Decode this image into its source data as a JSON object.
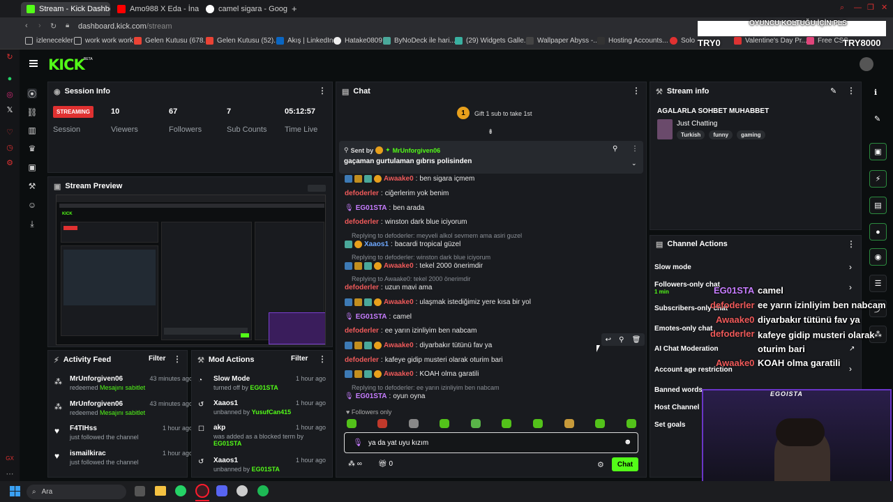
{
  "browser": {
    "tabs": [
      {
        "label": "Stream - Kick Dashboard",
        "active": true
      },
      {
        "label": "Amo988 X Eda - İnanırım",
        "active": false
      },
      {
        "label": "camel sigara - Google'da",
        "active": false
      }
    ],
    "new_tab": "+",
    "url_host": "dashboard.kick.com",
    "url_path": "/stream",
    "bookmarks": [
      "izlenecekler",
      "work work work",
      "Gelen Kutusu (678...",
      "Gelen Kutusu (52)...",
      "Akış | LinkedIn",
      "Hatake0809",
      "ByNoDeck ile hari...",
      "(29) Widgets Galle...",
      "Wallpaper Abyss -...",
      "Hosting Accounts...",
      "Solo -",
      "Valentine's Day Pr...",
      "Free CSS"
    ]
  },
  "kick": {
    "logo": "KICK",
    "logo_badge": "BETA"
  },
  "session": {
    "title": "Session Info",
    "badge": "STREAMING",
    "badge_sub": "Session",
    "stats": [
      {
        "value": "10",
        "label": "Viewers"
      },
      {
        "value": "67",
        "label": "Followers"
      },
      {
        "value": "7",
        "label": "Sub Counts"
      },
      {
        "value": "05:12:57",
        "label": "Time Live"
      }
    ]
  },
  "preview": {
    "title": "Stream Preview"
  },
  "activity": {
    "title": "Activity Feed",
    "filter": "Filter",
    "items": [
      {
        "user": "MrUnforgiven06",
        "action": "redeemed",
        "reward": "Mesajını sabitlet",
        "time": "43 minutes ago"
      },
      {
        "user": "MrUnforgiven06",
        "action": "redeemed",
        "reward": "Mesajını sabitlet",
        "time": "43 minutes ago"
      },
      {
        "user": "F4TIHss",
        "action": "just followed the channel",
        "reward": "",
        "time": "1 hour ago"
      },
      {
        "user": "ismailkirac",
        "action": "just followed the channel",
        "reward": "",
        "time": "1 hour ago"
      }
    ]
  },
  "mod": {
    "title": "Mod Actions",
    "filter": "Filter",
    "items": [
      {
        "title": "Slow Mode",
        "sub": "turned off by",
        "by": "EG01STA",
        "time": "1 hour ago"
      },
      {
        "title": "Xaaos1",
        "sub": "unbanned by",
        "by": "YusufCan415",
        "time": "1 hour ago"
      },
      {
        "title": "akp",
        "sub": "was added as a blocked term by",
        "by": "EG01STA",
        "time": "1 hour ago"
      },
      {
        "title": "Xaaos1",
        "sub": "unbanned by",
        "by": "EG01STA",
        "time": "1 hour ago"
      }
    ]
  },
  "chat": {
    "title": "Chat",
    "gift_count": "1",
    "gift_text": "Gift 1 sub to take 1st",
    "pinned_sent_by": "Sent by",
    "pinned_user": "MrUnforgiven06",
    "pinned_text": "gaçaman gurtulaman gıbrıs polisinden",
    "messages": [
      {
        "user": "Awaake0",
        "color": "#f05a5a",
        "text": "ben sigara içmem",
        "badges": true,
        "reply": ""
      },
      {
        "user": "defoderler",
        "color": "#f05a5a",
        "text": "ciğerlerim yok benim",
        "badges": false,
        "reply": ""
      },
      {
        "user": "EG01STA",
        "color": "#c77dff",
        "text": "ben arada",
        "badges": false,
        "reply": ""
      },
      {
        "user": "defoderler",
        "color": "#f05a5a",
        "text": "winston dark blue iciyorum",
        "badges": false,
        "reply": ""
      },
      {
        "user": "Xaaos1",
        "color": "#6ea8fe",
        "text": "bacardi tropical güzel",
        "badges": false,
        "reply": "Replying to defoderler: meyveli alkol sevmem ama asiri guzel"
      },
      {
        "user": "Awaake0",
        "color": "#f05a5a",
        "text": "tekel 2000 önerimdir",
        "badges": true,
        "reply": "Replying to defoderler: winston dark blue iciyorum"
      },
      {
        "user": "defoderler",
        "color": "#f05a5a",
        "text": "uzun mavi ama",
        "badges": false,
        "reply": "Replying to Awaake0: tekel 2000 önerimdir"
      },
      {
        "user": "Awaake0",
        "color": "#f05a5a",
        "text": "ulaşmak istediğimiz yere kısa bir yol",
        "badges": true,
        "reply": ""
      },
      {
        "user": "EG01STA",
        "color": "#c77dff",
        "text": "camel",
        "badges": false,
        "reply": ""
      },
      {
        "user": "defoderler",
        "color": "#f05a5a",
        "text": "ee yarın izinliyim ben nabcam",
        "badges": false,
        "reply": ""
      },
      {
        "user": "Awaake0",
        "color": "#f05a5a",
        "text": "diyarbakır tütünü fav ya",
        "badges": true,
        "reply": ""
      },
      {
        "user": "defoderler",
        "color": "#f05a5a",
        "text": "kafeye gidip musteri olarak oturim bari",
        "badges": false,
        "reply": ""
      },
      {
        "user": "Awaake0",
        "color": "#f05a5a",
        "text": "KOAH olma garatili",
        "badges": true,
        "reply": ""
      },
      {
        "user": "EG01STA",
        "color": "#c77dff",
        "text": "oyun oyna",
        "badges": false,
        "reply": "Replying to defoderler: ee yarın izinliyim ben nabcam"
      }
    ],
    "followers_only": "Followers only",
    "input_value": "ya da yat uyu kızım",
    "points": "0",
    "send": "Chat"
  },
  "stream_info": {
    "title": "Stream info",
    "stream_title": "AGALARLA SOHBET MUHABBET",
    "category": "Just Chatting",
    "tags": [
      "Turkish",
      "funny",
      "gaming"
    ]
  },
  "channel_actions": {
    "title": "Channel Actions",
    "items": [
      {
        "label": "Slow mode",
        "sub": ""
      },
      {
        "label": "Followers-only chat",
        "sub": "1 min"
      },
      {
        "label": "Subscribers-only chat",
        "sub": ""
      },
      {
        "label": "Emotes-only chat",
        "sub": ""
      },
      {
        "label": "AI Chat Moderation",
        "sub": ""
      },
      {
        "label": "Account age restriction",
        "sub": ""
      },
      {
        "label": "Banned words",
        "sub": ""
      },
      {
        "label": "Host Channel",
        "sub": ""
      },
      {
        "label": "Set goals",
        "sub": ""
      }
    ]
  },
  "overlay": {
    "top_banner": "OYUNCU KOLTUĞU İÇİN PLS",
    "top_left": "TRY0",
    "top_right": "TRY8000",
    "chat": [
      {
        "user": "EG01STA",
        "color": "#c77dff",
        "text": "camel"
      },
      {
        "user": "defoderler",
        "color": "#f05a5a",
        "text": "ee yarın izinliyim ben nabcam"
      },
      {
        "user": "Awaake0",
        "color": "#f05a5a",
        "text": "diyarbakır tütünü fav ya"
      },
      {
        "user": "defoderler",
        "color": "#f05a5a",
        "text": "kafeye gidip musteri olarak oturim bari"
      },
      {
        "user": "Awaake0",
        "color": "#f05a5a",
        "text": "KOAH olma garatili"
      }
    ],
    "cam_label": "EGOISTA"
  },
  "taskbar": {
    "search": "Ara"
  },
  "colors": {
    "kick_green": "#53fc18",
    "streaming_red": "#e03131",
    "panel": "#191b1f",
    "bg": "#0b0e0f"
  }
}
